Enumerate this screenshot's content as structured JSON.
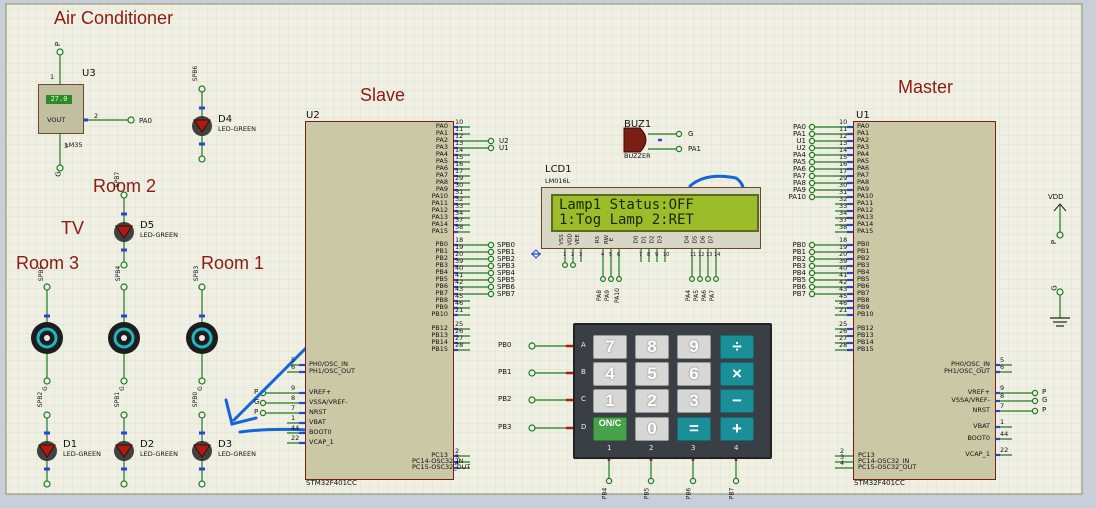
{
  "headings": {
    "air_conditioner": "Air Conditioner",
    "slave": "Slave",
    "master": "Master",
    "room2": "Room 2",
    "tv": "TV",
    "room3": "Room 3",
    "room1": "Room 1"
  },
  "sensor": {
    "ref": "U3",
    "display": "27.0",
    "vout": "VOUT",
    "model": "LM35",
    "pin1": "1",
    "pin2": "2",
    "pin3": "3",
    "net": "PA0",
    "power": "P",
    "gnd": "G"
  },
  "leds": [
    {
      "ref": "D4",
      "type": "LED-GREEN",
      "net": "SPB6"
    },
    {
      "ref": "D5",
      "type": "LED-GREEN",
      "net": "SPB7"
    },
    {
      "ref": "D1",
      "type": "LED-GREEN",
      "net": "SPB2"
    },
    {
      "ref": "D2",
      "type": "LED-GREEN",
      "net": "SPB1"
    },
    {
      "ref": "D3",
      "type": "LED-GREEN",
      "net": "SPB0"
    }
  ],
  "motors": {
    "nets": [
      "SPB5",
      "SPB4",
      "SPB3"
    ],
    "gnd": "G"
  },
  "slave": {
    "ref": "U2",
    "model": "STM32F401CC",
    "pa_pins": [
      "PA0",
      "PA1",
      "PA2",
      "PA3",
      "PA4",
      "PA5",
      "PA6",
      "PA7",
      "PA8",
      "PA9",
      "PA10",
      "PA11",
      "PA12",
      "PA13",
      "PA14",
      "PA15"
    ],
    "pa_nums": [
      "10",
      "11",
      "12",
      "13",
      "14",
      "15",
      "16",
      "17",
      "29",
      "30",
      "31",
      "32",
      "33",
      "34",
      "37",
      "38"
    ],
    "pb_pins": [
      "PB0",
      "PB1",
      "PB2",
      "PB3",
      "PB4",
      "PB5",
      "PB6",
      "PB7",
      "PB8",
      "PB9",
      "PB10",
      "PB12",
      "PB13",
      "PB14",
      "PB15"
    ],
    "pb_nums": [
      "18",
      "19",
      "20",
      "39",
      "40",
      "41",
      "42",
      "43",
      "45",
      "46",
      "21",
      "25",
      "26",
      "27",
      "28"
    ],
    "pb_nets": [
      "SPB0",
      "SPB1",
      "SPB2",
      "SPB3",
      "SPB4",
      "SPB5",
      "SPB6",
      "SPB7"
    ],
    "u2_nets": [
      "U2",
      "U1"
    ],
    "left_pins": [
      "PH0/OSC_IN",
      "PH1/OSC_OUT",
      "VREF+",
      "VSSA/VREF-",
      "NRST",
      "VBAT",
      "BOOT0",
      "VCAP_1"
    ],
    "left_nums": [
      "5",
      "6",
      "9",
      "8",
      "7",
      "1",
      "44",
      "22"
    ],
    "left_nets": [
      "P",
      "G",
      "P"
    ],
    "bottom_pins": [
      "PC13",
      "PC14-OSC32_IN",
      "PC15-OSC32_OUT"
    ],
    "bottom_nums": [
      "2",
      "3",
      "4"
    ]
  },
  "master": {
    "ref": "U1",
    "model": "STM32F401CC",
    "pa_pins": [
      "PA0",
      "PA1",
      "PA2",
      "PA3",
      "PA4",
      "PA5",
      "PA6",
      "PA7",
      "PA8",
      "PA9",
      "PA10",
      "PA11",
      "PA12",
      "PA13",
      "PA14",
      "PA15"
    ],
    "pa_nums": [
      "10",
      "11",
      "12",
      "13",
      "14",
      "15",
      "16",
      "17",
      "29",
      "30",
      "31",
      "32",
      "33",
      "34",
      "37",
      "38"
    ],
    "pa_nets": [
      "PA0",
      "PA1",
      "U1",
      "U2",
      "PA4",
      "PA5",
      "PA6",
      "PA7",
      "PA8",
      "PA9",
      "PA10"
    ],
    "pb_pins": [
      "PB0",
      "PB1",
      "PB2",
      "PB3",
      "PB4",
      "PB5",
      "PB6",
      "PB7",
      "PB8",
      "PB9",
      "PB10",
      "PB12",
      "PB13",
      "PB14",
      "PB15"
    ],
    "pb_nums": [
      "18",
      "19",
      "20",
      "39",
      "40",
      "41",
      "42",
      "43",
      "45",
      "46",
      "21",
      "25",
      "26",
      "27",
      "28"
    ],
    "pb_nets": [
      "PB0",
      "PB1",
      "PB2",
      "PB3",
      "PB4",
      "PB5",
      "PB6",
      "PB7"
    ],
    "right_pins": [
      "PH0/OSC_IN",
      "PH1/OSC_OUT",
      "VREF+",
      "VSSA/VREF-",
      "NRST",
      "VBAT",
      "BOOT0",
      "VCAP_1"
    ],
    "right_nums": [
      "5",
      "6",
      "9",
      "8",
      "7",
      "1",
      "44",
      "22"
    ],
    "right_nets": [
      "P",
      "G",
      "P"
    ],
    "bottom_pins": [
      "PC13",
      "PC14-OSC32_IN",
      "PC15-OSC32_OUT"
    ],
    "bottom_nums": [
      "2",
      "3",
      "4"
    ]
  },
  "buzzer": {
    "ref": "BUZ1",
    "type": "BUZZER",
    "nets": [
      "G",
      "PA1"
    ]
  },
  "lcd": {
    "ref": "LCD1",
    "model": "LM016L",
    "line1": "Lamp1 Status:OFF",
    "line2": "1:Tog Lamp 2:RET",
    "pins": [
      "VSS",
      "VDD",
      "VEE",
      "RS",
      "RW",
      "E",
      "D0",
      "D1",
      "D2",
      "D3",
      "D4",
      "D5",
      "D6",
      "D7"
    ],
    "nets_left": [
      "PA8",
      "PA9",
      "PA10"
    ],
    "nets_right": [
      "PA4",
      "PA5",
      "PA6",
      "PA7"
    ]
  },
  "keypad": {
    "rows": [
      "A",
      "B",
      "C",
      "D"
    ],
    "row_nets": [
      "PB0",
      "PB1",
      "PB2",
      "PB3"
    ],
    "cols": [
      "1",
      "2",
      "3",
      "4"
    ],
    "col_nets": [
      "PB4",
      "PB5",
      "PB6",
      "PB7"
    ],
    "keys": [
      "7",
      "8",
      "9",
      "÷",
      "4",
      "5",
      "6",
      "×",
      "1",
      "2",
      "3",
      "−",
      "ON/C",
      "0",
      "=",
      "+"
    ]
  },
  "power": {
    "vdd": "VDD",
    "p": "P",
    "g": "G"
  },
  "colors": {
    "wire": "#1f7a1f",
    "chip_fill": "#cbc8a6",
    "chip_border": "#7a1d12",
    "heading": "#8b1a12",
    "annotation": "#1565d8",
    "grid": "#d7dbc8",
    "sheet": "#efefe4"
  }
}
